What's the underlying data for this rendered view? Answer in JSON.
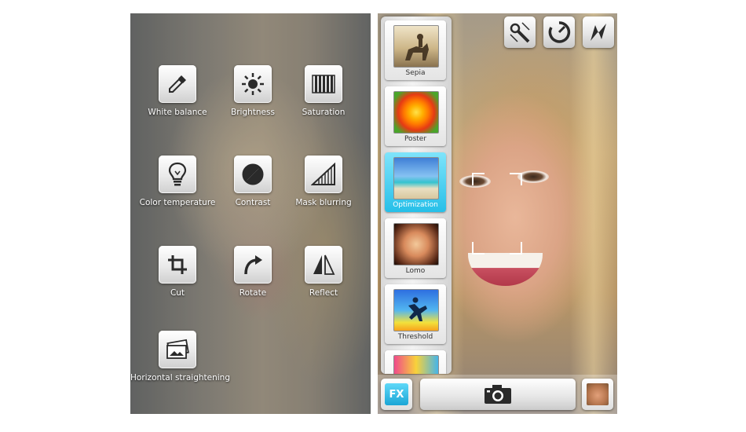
{
  "edit_tools": [
    {
      "label": "White balance",
      "icon": "eyedropper-icon"
    },
    {
      "label": "Brightness",
      "icon": "sun-icon"
    },
    {
      "label": "Saturation",
      "icon": "bars-icon"
    },
    {
      "label": "Color temperature",
      "icon": "lightbulb-icon"
    },
    {
      "label": "Contrast",
      "icon": "contrast-icon"
    },
    {
      "label": "Mask blurring",
      "icon": "gradient-triangle-icon"
    },
    {
      "label": "Cut",
      "icon": "crop-icon"
    },
    {
      "label": "Rotate",
      "icon": "rotate-arrow-icon"
    },
    {
      "label": "Reflect",
      "icon": "mirror-icon"
    },
    {
      "label": "Horizontal straightening",
      "icon": "photos-icon"
    }
  ],
  "effects": [
    {
      "label": "Sepia",
      "selected": false
    },
    {
      "label": "Poster",
      "selected": false
    },
    {
      "label": "Optimization",
      "selected": true
    },
    {
      "label": "Lomo",
      "selected": false
    },
    {
      "label": "Threshold",
      "selected": false
    }
  ],
  "camera_controls": {
    "top_buttons": [
      "antishake-icon",
      "timer-icon",
      "flash-icon"
    ],
    "fx_label": "FX"
  },
  "colors": {
    "selected_effect": "#26bfe8",
    "fx_button": "#1ba6d6",
    "tool_label": "#ffffff"
  }
}
